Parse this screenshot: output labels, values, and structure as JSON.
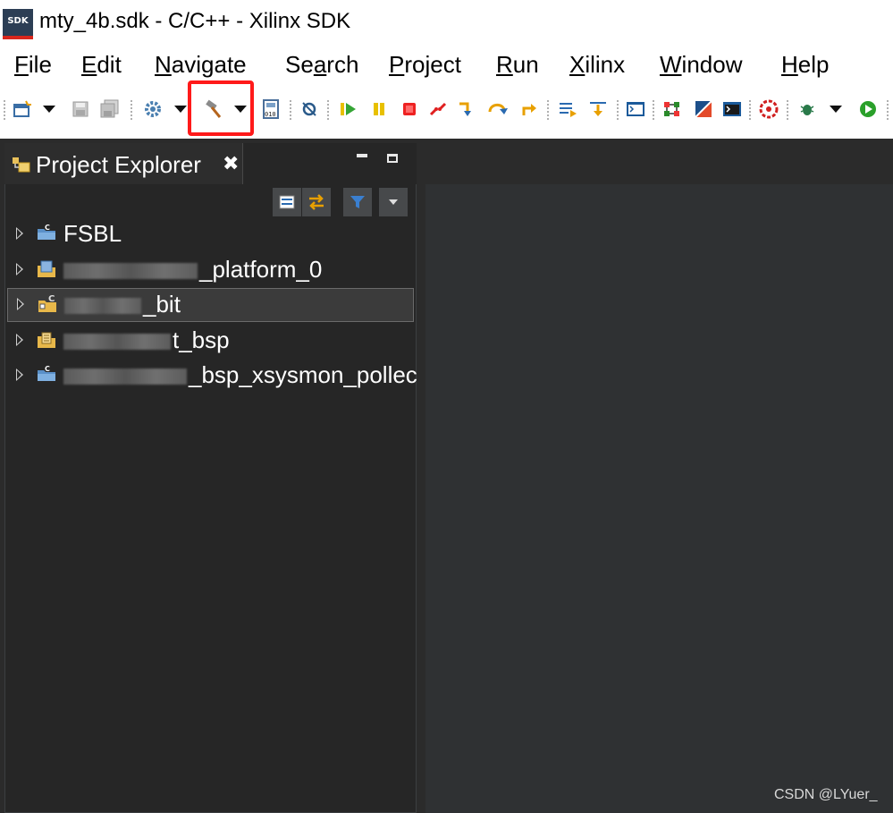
{
  "window": {
    "app_icon_text": "SDK",
    "title": "mty_4b.sdk - C/C++ - Xilinx SDK"
  },
  "menubar": {
    "items": [
      {
        "mnemonic": "F",
        "rest": "ile"
      },
      {
        "mnemonic": "E",
        "rest": "dit"
      },
      {
        "mnemonic": "N",
        "rest": "avigate"
      },
      {
        "pre": "Se",
        "mnemonic": "a",
        "rest": "rch"
      },
      {
        "mnemonic": "P",
        "rest": "roject"
      },
      {
        "mnemonic": "R",
        "rest": "un"
      },
      {
        "mnemonic": "X",
        "rest": "ilinx"
      },
      {
        "mnemonic": "W",
        "rest": "indow"
      },
      {
        "mnemonic": "H",
        "rest": "elp"
      }
    ]
  },
  "toolbar": {
    "icons": [
      "new-icon",
      "new-dropdown-icon",
      "save-icon",
      "save-all-icon",
      "gear-icon",
      "gear-dropdown-icon",
      "build-hammer-icon",
      "build-dropdown-icon",
      "program-fpga-icon",
      "skip-breakpoints-icon",
      "resume-icon",
      "suspend-icon",
      "terminate-icon",
      "disconnect-icon",
      "step-into-icon",
      "step-over-icon",
      "step-return-icon",
      "instruction-step-icon",
      "drop-to-frame-icon",
      "terminal-icon",
      "settings-icon",
      "xilinx-tool-icon",
      "console-icon",
      "debug-config-icon",
      "bug-icon",
      "debug-dropdown-icon",
      "run-icon"
    ],
    "highlight_color": "#ff1a1a"
  },
  "project_explorer": {
    "tab_label": "Project Explorer",
    "close_glyph": "✖",
    "toolbar_icons": [
      "collapse-all-icon",
      "link-editor-icon",
      "filter-icon",
      "view-menu-icon"
    ],
    "items": [
      {
        "label": "FSBL",
        "icon": "c-project-icon"
      },
      {
        "label": "_platform_0",
        "icon": "hardware-platform-icon"
      },
      {
        "label": "_bit",
        "icon": "application-project-icon",
        "selected": true
      },
      {
        "label": "t_bsp",
        "icon": "bsp-project-icon"
      },
      {
        "label": "_bsp_xsysmon_pollec",
        "icon": "c-project-icon"
      }
    ]
  },
  "watermark": "CSDN @LYuer_",
  "colors": {
    "panel_bg": "#262626",
    "editor_bg": "#2f3133",
    "selection_bg": "#3b3b3b"
  }
}
